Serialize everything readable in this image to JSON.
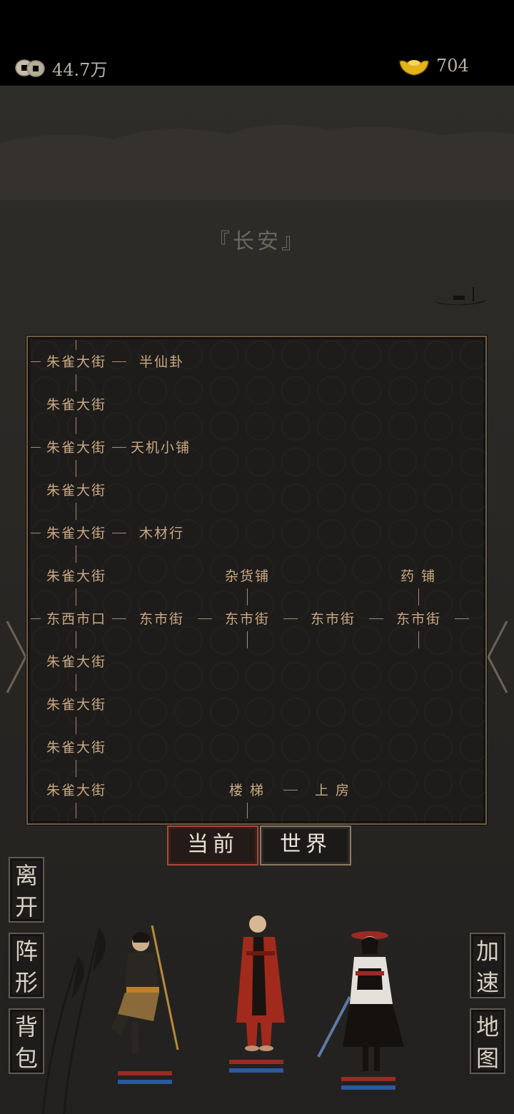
{
  "header": {
    "coins": "44.7万",
    "ingots": "704"
  },
  "location": {
    "city_title": "『长安』"
  },
  "map": {
    "rows": [
      {
        "main": "朱雀大街",
        "side": "半仙卦"
      },
      {
        "main": "朱雀大街"
      },
      {
        "main": "朱雀大街",
        "side": "天机小铺"
      },
      {
        "main": "朱雀大街"
      },
      {
        "main": "朱雀大街",
        "side": "木材行"
      },
      {
        "main": "朱雀大街",
        "shop1": "杂货铺",
        "shop2": "药 铺"
      },
      {
        "main": "东西市口",
        "east": [
          "东市街",
          "东市街",
          "东市街",
          "东市街"
        ]
      },
      {
        "main": "朱雀大街"
      },
      {
        "main": "朱雀大街"
      },
      {
        "main": "朱雀大街"
      },
      {
        "main": "朱雀大街",
        "stairs": "楼 梯",
        "room": "上 房"
      }
    ]
  },
  "tabs": {
    "current": "当前",
    "world": "世界"
  },
  "side_buttons": {
    "leave": "离开",
    "formation": "阵形",
    "bag": "背包",
    "speed": "加速",
    "map": "地图"
  },
  "colors": {
    "map_text": "#c9a984",
    "hp_bar": "#9b2a22",
    "mp_bar": "#2a5aa0"
  },
  "icons": {
    "coin": "coin-icon",
    "ingot": "ingot-icon"
  }
}
